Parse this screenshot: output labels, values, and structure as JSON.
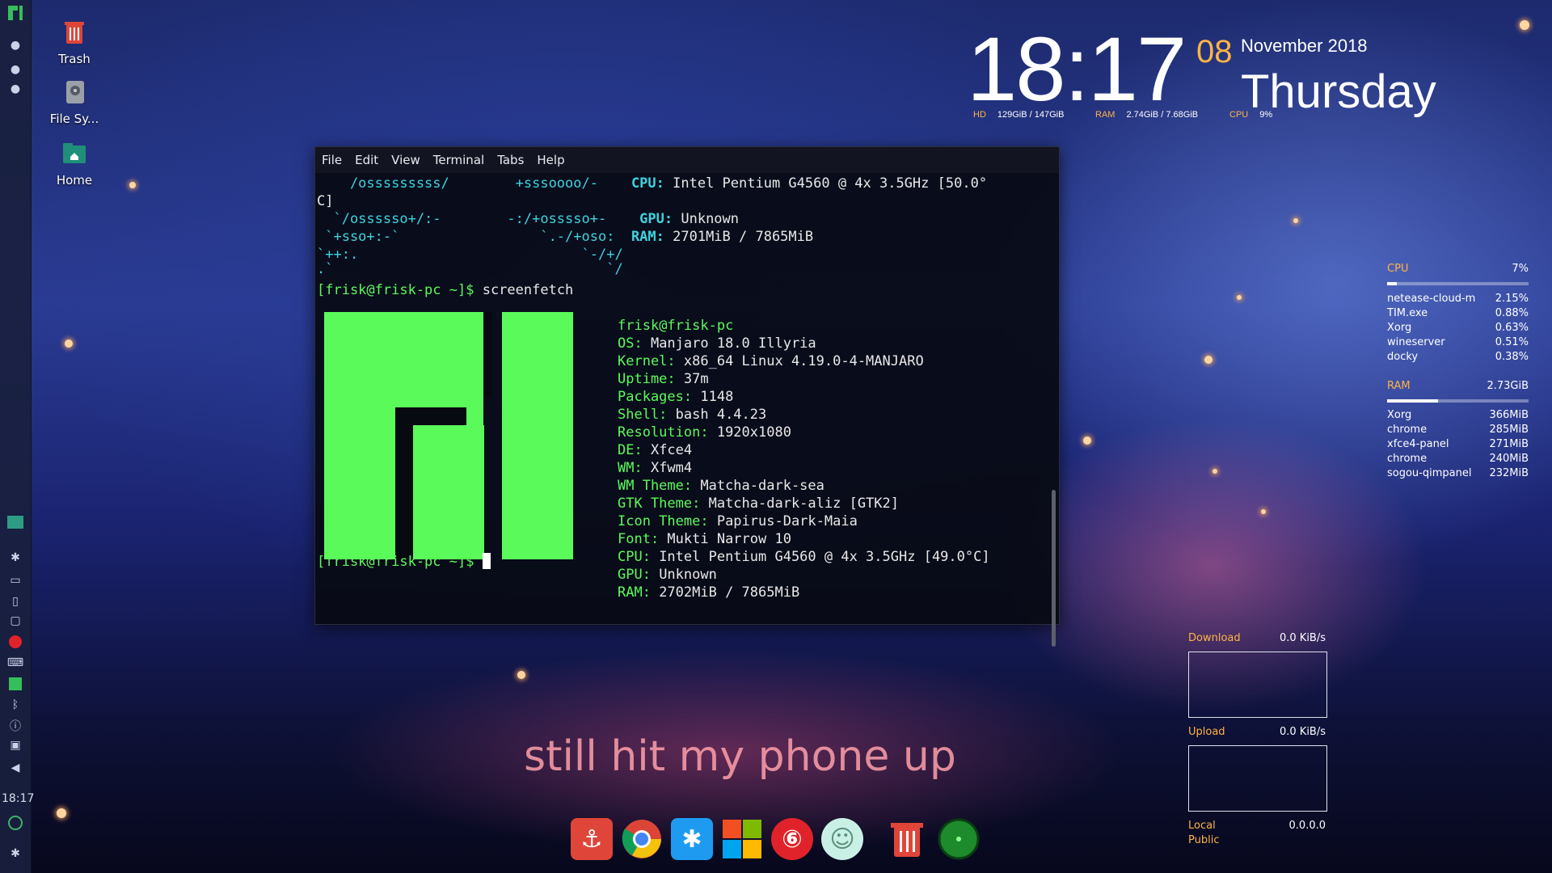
{
  "desktop": {
    "icons": [
      {
        "label": "Trash",
        "icon": "trash-icon"
      },
      {
        "label": "File Sy...",
        "icon": "drive-icon"
      },
      {
        "label": "Home",
        "icon": "home-folder-icon"
      }
    ],
    "lyrics": "still hit my phone up"
  },
  "panel": {
    "clock": "18:17"
  },
  "clock_widget": {
    "time": "18:17",
    "day": "08",
    "month_year": "November 2018",
    "weekday": "Thursday",
    "hd_label": "HD",
    "hd_value": "129GiB / 147GiB",
    "ram_label": "RAM",
    "ram_value": "2.74GiB / 7.68GiB",
    "cpu_label": "CPU",
    "cpu_value": "9%"
  },
  "terminal": {
    "menu": [
      "File",
      "Edit",
      "View",
      "Terminal",
      "Tabs",
      "Help"
    ],
    "scroll_prev": {
      "a1": "    /osssssssss/        +sssoooo/-    ",
      "a1_label": "CPU:",
      "a1_value": " Intel Pentium G4560 @ 4x 3.5GHz [50.0°",
      "a1_wrap": "C]",
      "a2": "  `/ossssso+/:-        -:/+osssso+-    ",
      "a2_label": "GPU:",
      "a2_value": " Unknown",
      "a3": " `+sso+:-`                 `.-/+oso:  ",
      "a3_label": "RAM:",
      "a3_value": " 2701MiB / 7865MiB",
      "a4": "`++:.                           `-/+/",
      "a5": ".`                                 `/"
    },
    "prompt": "[frisk@frisk-pc ~]$",
    "command": " screenfetch",
    "user": "frisk",
    "at_host": "@frisk-pc",
    "info": [
      {
        "label": "OS:",
        "value": " Manjaro 18.0 Illyria"
      },
      {
        "label": "Kernel:",
        "value": " x86_64 Linux 4.19.0-4-MANJARO"
      },
      {
        "label": "Uptime:",
        "value": " 37m"
      },
      {
        "label": "Packages:",
        "value": " 1148"
      },
      {
        "label": "Shell:",
        "value": " bash 4.4.23"
      },
      {
        "label": "Resolution:",
        "value": " 1920x1080"
      },
      {
        "label": "DE:",
        "value": " Xfce4"
      },
      {
        "label": "WM:",
        "value": " Xfwm4"
      },
      {
        "label": "WM Theme:",
        "value": " Matcha-dark-sea"
      },
      {
        "label": "GTK Theme:",
        "value": " Matcha-dark-aliz [GTK2]"
      },
      {
        "label": "Icon Theme:",
        "value": " Papirus-Dark-Maia"
      },
      {
        "label": "Font:",
        "value": " Mukti Narrow 10"
      },
      {
        "label": "CPU:",
        "value": " Intel Pentium G4560 @ 4x 3.5GHz [49.0°C]"
      },
      {
        "label": "GPU:",
        "value": " Unknown"
      },
      {
        "label": "RAM:",
        "value": " 2702MiB / 7865MiB"
      }
    ],
    "final_prompt": "[frisk@frisk-pc ~]$"
  },
  "conky": {
    "cpu_label": "CPU",
    "cpu_value": "7%",
    "cpu_fraction": 0.07,
    "cpu_procs": [
      {
        "name": "netease-cloud-m",
        "val": "2.15%"
      },
      {
        "name": "TIM.exe",
        "val": "0.88%"
      },
      {
        "name": "Xorg",
        "val": "0.63%"
      },
      {
        "name": "wineserver",
        "val": "0.51%"
      },
      {
        "name": "docky",
        "val": "0.38%"
      }
    ],
    "ram_label": "RAM",
    "ram_value": "2.73GiB",
    "ram_fraction": 0.36,
    "ram_procs": [
      {
        "name": "Xorg",
        "val": "366MiB"
      },
      {
        "name": "chrome",
        "val": "285MiB"
      },
      {
        "name": "xfce4-panel",
        "val": "271MiB"
      },
      {
        "name": "chrome",
        "val": "240MiB"
      },
      {
        "name": "sogou-qimpanel",
        "val": "232MiB"
      }
    ],
    "download_label": "Download",
    "download_value": "0.0 KiB/s",
    "upload_label": "Upload",
    "upload_value": "0.0 KiB/s",
    "local_label": "Local",
    "local_value": "0.0.0.0",
    "public_label": "Public"
  },
  "dock": [
    {
      "name": "anchor-icon",
      "color": "#e0453a"
    },
    {
      "name": "chrome-icon",
      "color": "#ffffff"
    },
    {
      "name": "tim-icon",
      "color": "#1e9bf0"
    },
    {
      "name": "windows-icon",
      "color": "#f2b01e"
    },
    {
      "name": "netease-music-icon",
      "color": "#e0232a"
    },
    {
      "name": "anime-avatar-icon",
      "color": "#c9f0e4"
    },
    {
      "name": "trash-icon",
      "color": "#e0453a"
    },
    {
      "name": "radar-icon",
      "color": "#1d8a2c"
    }
  ],
  "colors": {
    "accent": "#ffb347",
    "terminal_green": "#5bfa5b",
    "terminal_cyan": "#3fd3e0"
  }
}
